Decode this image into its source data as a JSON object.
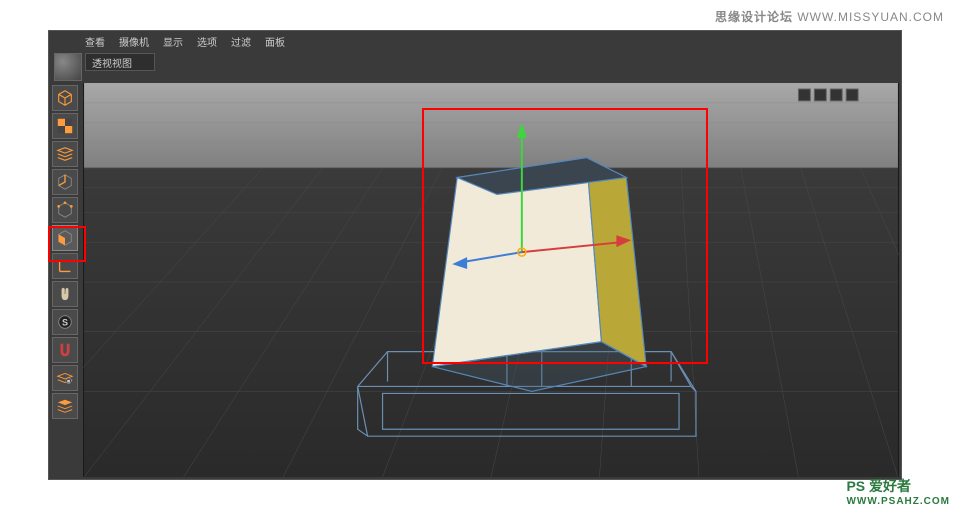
{
  "watermark": {
    "top_cn": "思缘设计论坛",
    "top_url": "WWW.MISSYUAN.COM",
    "bot_main": "PS 爱好者",
    "bot_url": "WWW.PSAHZ.COM"
  },
  "menubar": {
    "view": "查看",
    "camera": "摄像机",
    "display": "显示",
    "options": "选项",
    "filter": "过滤",
    "panel": "面板"
  },
  "viewport": {
    "title": "透视视图"
  },
  "tools": {
    "model": "model-tool",
    "texture": "texture-tool",
    "workplane": "workplane-tool",
    "edge": "edge-tool",
    "point": "point-tool",
    "polygon": "polygon-tool",
    "axis": "axis-tool",
    "tweak": "tweak-tool",
    "snap": "snap-tool",
    "magnet": "magnet-tool",
    "lock": "lock-tool",
    "layer": "layer-tool"
  },
  "icons": {
    "cube": "cube-icon",
    "checker": "checker-icon",
    "stack": "stack-icon",
    "edge_i": "edge-icon",
    "point_i": "point-icon",
    "poly": "polygon-icon",
    "angle": "axis-icon",
    "hand": "hand-icon",
    "s": "snap-icon",
    "mag": "magnet-icon",
    "lock_i": "lock-icon",
    "layer_i": "layer-icon"
  },
  "selected_object": "prism"
}
